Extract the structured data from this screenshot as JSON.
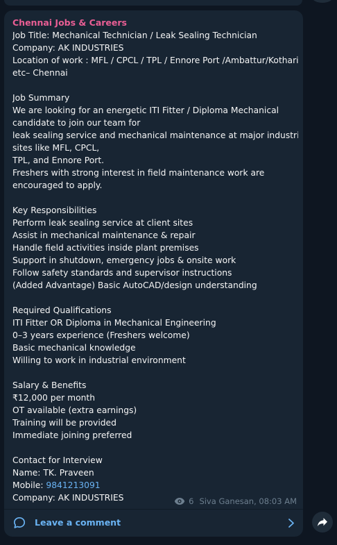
{
  "post": {
    "sender": "Chennai Jobs & Careers",
    "lines": [
      "Job Title: Mechanical Technician / Leak Sealing Technician",
      "Company: AK INDUSTRIES",
      "Location of work : MFL / CPCL / TPL / Ennore Port /Ambattur/Kothari",
      "etc– Chennai",
      "",
      "Job Summary",
      "We are looking for an energetic ITI Fitter / Diploma Mechanical",
      "candidate to join our team for",
      "leak sealing service and mechanical maintenance at major industrial",
      "sites like MFL, CPCL,",
      "TPL, and Ennore Port.",
      "Freshers with strong interest in field maintenance work are",
      "encouraged to apply.",
      "",
      "Key Responsibilities",
      "Perform leak sealing service at client sites",
      "Assist in mechanical maintenance & repair",
      "Handle field activities inside plant premises",
      "Support in shutdown, emergency jobs & onsite work",
      "Follow safety standards and supervisor instructions",
      "(Added Advantage) Basic AutoCAD/design understanding",
      "",
      "Required Qualifications",
      "ITI Fitter OR Diploma in Mechanical Engineering",
      "0–3 years experience (Freshers welcome)",
      "Basic mechanical knowledge",
      "Willing to work in industrial environment",
      "",
      "Salary & Benefits",
      "₹12,000 per month",
      "OT available (extra earnings)",
      "Training will be provided",
      "Immediate joining preferred",
      "",
      "Contact for Interview",
      "Name: TK. Praveen"
    ],
    "mobile_label": "Mobile: ",
    "mobile_number": "9841213091",
    "last_line": "Company: AK INDUSTRIES",
    "views": "6",
    "author_time": "Siva Ganesan, 08:03 AM"
  },
  "comments": {
    "label": "Leave a comment"
  },
  "icons": {
    "views": "eye-icon",
    "comment": "comment-bubble-icon",
    "open": "chevron-right-icon",
    "share": "share-arrow-icon"
  },
  "colors": {
    "background": "#0e1621",
    "bubble": "#182533",
    "sender": "#e95e94",
    "link": "#6ab3f3",
    "meta": "#6d7f8f",
    "text": "#f5f5f5"
  }
}
